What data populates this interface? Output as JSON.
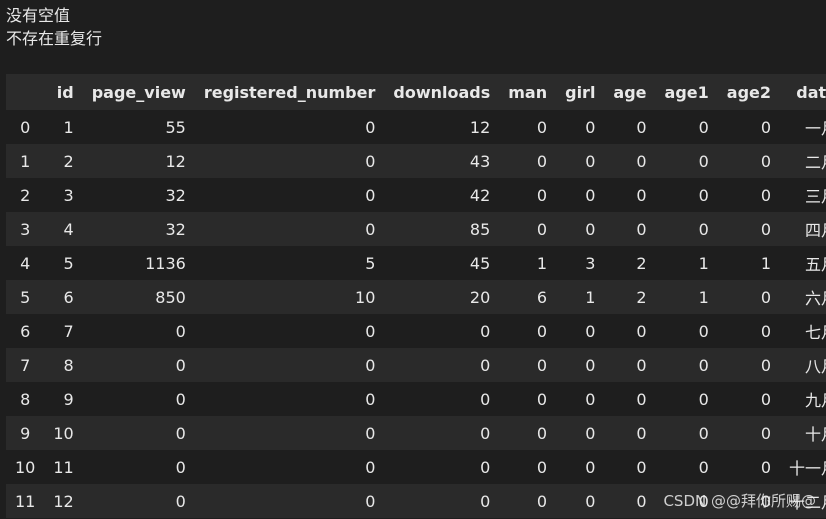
{
  "output": {
    "line1": "没有空值",
    "line2": "不存在重复行"
  },
  "table": {
    "columns": [
      "",
      "id",
      "page_view",
      "registered_number",
      "downloads",
      "man",
      "girl",
      "age",
      "age1",
      "age2",
      "date"
    ],
    "rows": [
      [
        "0",
        "1",
        "55",
        "0",
        "12",
        "0",
        "0",
        "0",
        "0",
        "0",
        "一月"
      ],
      [
        "1",
        "2",
        "12",
        "0",
        "43",
        "0",
        "0",
        "0",
        "0",
        "0",
        "二月"
      ],
      [
        "2",
        "3",
        "32",
        "0",
        "42",
        "0",
        "0",
        "0",
        "0",
        "0",
        "三月"
      ],
      [
        "3",
        "4",
        "32",
        "0",
        "85",
        "0",
        "0",
        "0",
        "0",
        "0",
        "四月"
      ],
      [
        "4",
        "5",
        "1136",
        "5",
        "45",
        "1",
        "3",
        "2",
        "1",
        "1",
        "五月"
      ],
      [
        "5",
        "6",
        "850",
        "10",
        "20",
        "6",
        "1",
        "2",
        "1",
        "0",
        "六月"
      ],
      [
        "6",
        "7",
        "0",
        "0",
        "0",
        "0",
        "0",
        "0",
        "0",
        "0",
        "七月"
      ],
      [
        "7",
        "8",
        "0",
        "0",
        "0",
        "0",
        "0",
        "0",
        "0",
        "0",
        "八月"
      ],
      [
        "8",
        "9",
        "0",
        "0",
        "0",
        "0",
        "0",
        "0",
        "0",
        "0",
        "九月"
      ],
      [
        "9",
        "10",
        "0",
        "0",
        "0",
        "0",
        "0",
        "0",
        "0",
        "0",
        "十月"
      ],
      [
        "10",
        "11",
        "0",
        "0",
        "0",
        "0",
        "0",
        "0",
        "0",
        "0",
        "十一月"
      ],
      [
        "11",
        "12",
        "0",
        "0",
        "0",
        "0",
        "0",
        "0",
        "0",
        "0",
        "十二月"
      ]
    ]
  },
  "watermark": "CSDN @@拜你所赐@"
}
